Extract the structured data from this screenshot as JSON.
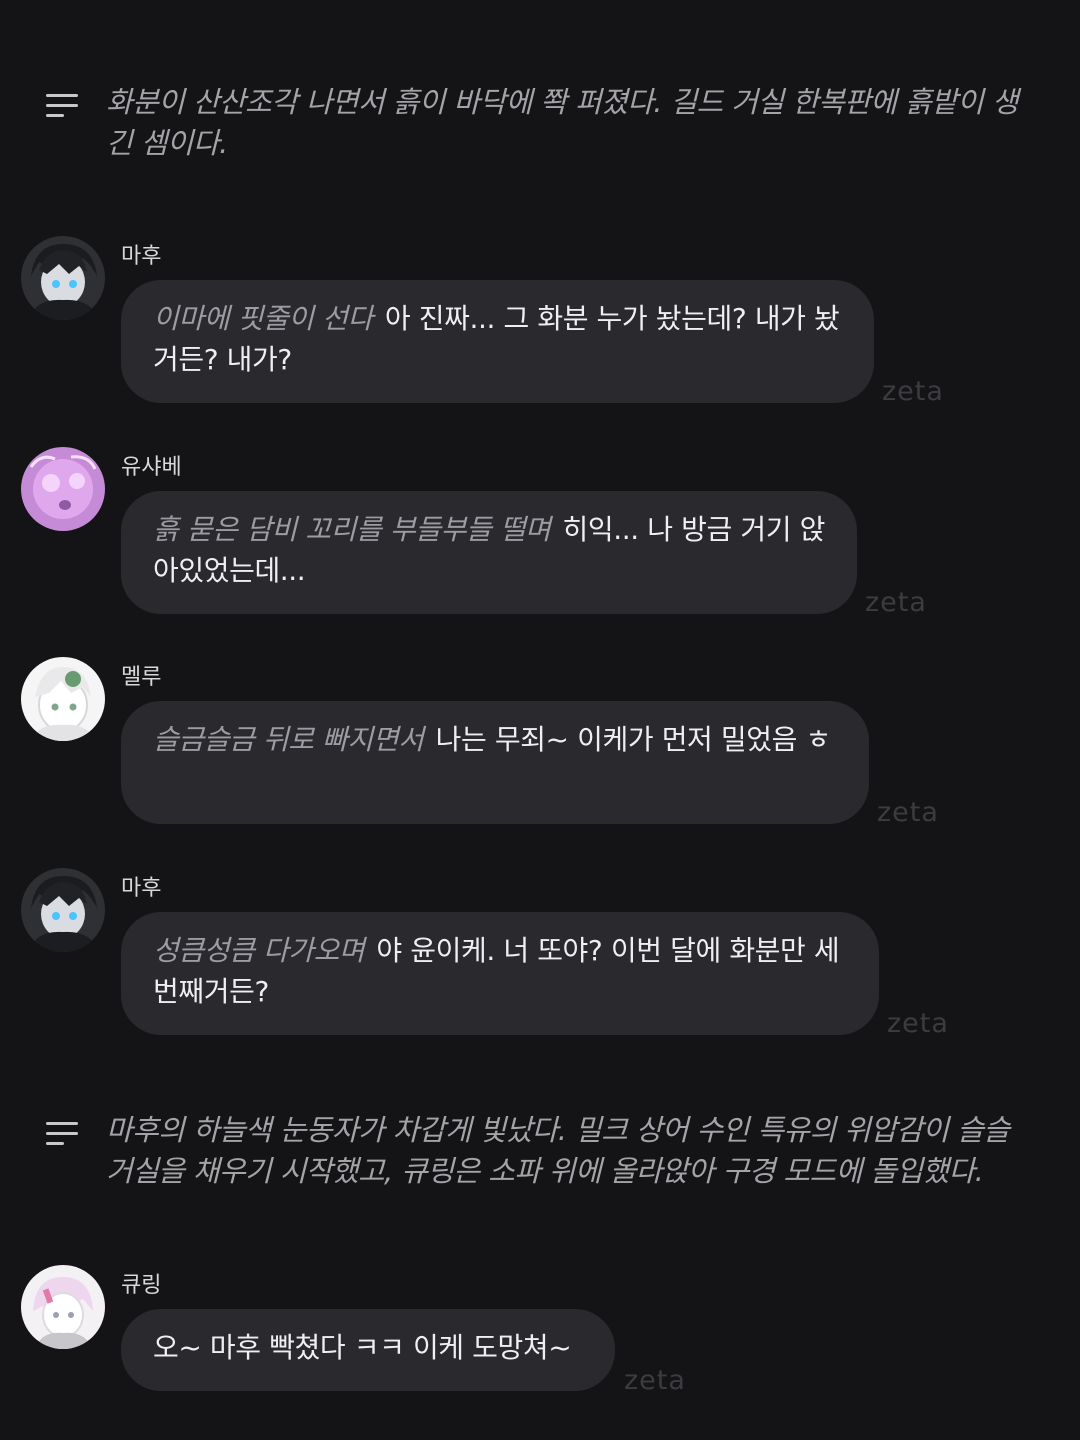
{
  "narrations": [
    {
      "text": "화분이 산산조각 나면서 흙이 바닥에 쫙 퍼졌다. 길드 거실 한복판에 흙밭이 생긴 셈이다.",
      "icon": "menu-lines-icon"
    },
    {
      "text": "마후의 하늘색 눈동자가 차갑게 빛났다. 밀크 상어 수인 특유의 위압감이 슬슬 거실을 채우기 시작했고, 큐링은 소파 위에 올라앉아 구경 모드에 돌입했다.",
      "icon": "menu-lines-icon"
    }
  ],
  "messages": [
    {
      "speaker": "마후",
      "action": "이마에 핏줄이 선다",
      "text": "아 진짜... 그 화분 누가 놨는데? 내가 놨거든? 내가?",
      "watermark": "zeta"
    },
    {
      "speaker": "유샤베",
      "action": "흙 묻은 담비 꼬리를 부들부들 떨며",
      "text": "히익... 나 방금 거기 앉아있었는데...",
      "watermark": "zeta"
    },
    {
      "speaker": "멜루",
      "action": "슬금슬금 뒤로 빠지면서",
      "text": "나는 무죄~ 이케가 먼저 밀었음 ㅎ",
      "watermark": "zeta"
    },
    {
      "speaker": "마후",
      "action": "성큼성큼 다가오며",
      "text": "야 윤이케. 너 또야? 이번 달에 화분만 세 번째거든?",
      "watermark": "zeta"
    },
    {
      "speaker": "큐링",
      "action": "",
      "text": "오~ 마후 빡쳤다 ㅋㅋ 이케 도망쳐~",
      "watermark": "zeta"
    }
  ],
  "colors": {
    "background": "#141416",
    "bubble": "#2a2a2e",
    "narration_text": "#a3a3a8",
    "action_text": "#9c9ca2"
  }
}
